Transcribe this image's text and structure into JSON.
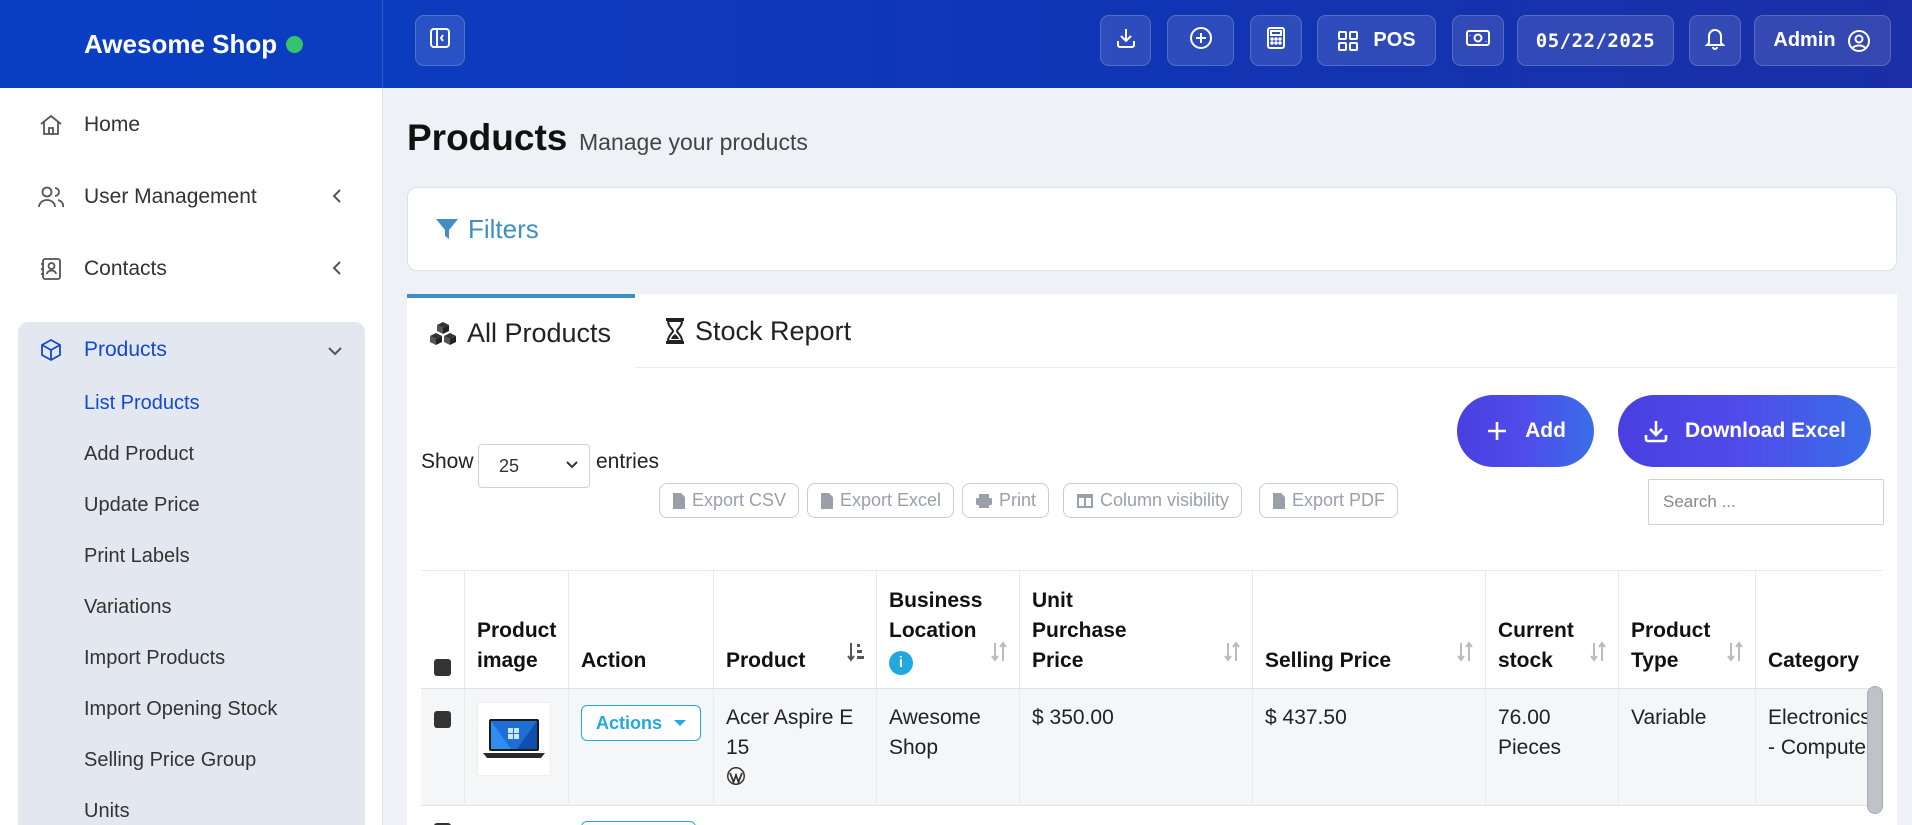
{
  "brand": {
    "name": "Awesome Shop",
    "status_color": "#34c46b"
  },
  "topbar": {
    "pos_label": "POS",
    "date": "05/22/2025",
    "user_label": "Admin"
  },
  "sidebar": {
    "items": [
      {
        "label": "Home",
        "icon": "home-icon"
      },
      {
        "label": "User Management",
        "icon": "users-icon"
      },
      {
        "label": "Contacts",
        "icon": "contacts-icon"
      },
      {
        "label": "Products",
        "icon": "cube-icon"
      }
    ],
    "product_subitems": [
      "List Products",
      "Add Product",
      "Update Price",
      "Print Labels",
      "Variations",
      "Import Products",
      "Import Opening Stock",
      "Selling Price Group",
      "Units"
    ]
  },
  "page": {
    "title": "Products",
    "subtitle": "Manage your products"
  },
  "filters": {
    "label": "Filters"
  },
  "tabs": [
    "All Products",
    "Stock Report"
  ],
  "controls": {
    "show_label": "Show",
    "entries_value": "25",
    "entries_label": "entries",
    "add_label": "Add",
    "download_excel_label": "Download Excel",
    "search_placeholder": "Search ...",
    "export_buttons": [
      "Export CSV",
      "Export Excel",
      "Print",
      "Column visibility",
      "Export PDF"
    ]
  },
  "table": {
    "headers": [
      "Product image",
      "Action",
      "Product",
      "Business Location",
      "Unit Purchase Price",
      "Selling Price",
      "Current stock",
      "Product Type",
      "Category"
    ],
    "rows": [
      {
        "action": "Actions",
        "product": "Acer Aspire E 15",
        "location": "Awesome Shop",
        "purchase_price": "$ 350.00",
        "selling_price": "$ 437.50",
        "stock": "76.00 Pieces",
        "type": "Variable",
        "category": "Electronics -- Computers"
      }
    ]
  },
  "colors": {
    "accent": "#1548d0",
    "filter": "#3f8fc4",
    "action": "#23a7e0"
  }
}
